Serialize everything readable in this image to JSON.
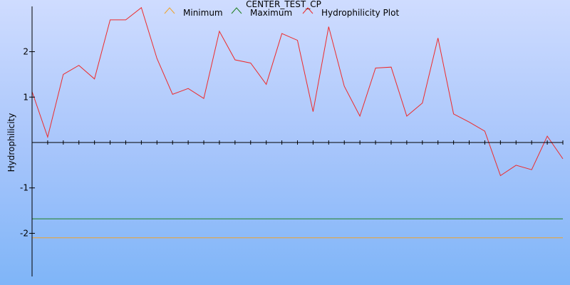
{
  "chart_data": {
    "type": "line",
    "title": "CENTER_TEST_CP",
    "xlabel": "",
    "ylabel": "Hydrophilicity",
    "ylim": [
      -2.95,
      2.95
    ],
    "xlim": [
      0,
      34
    ],
    "y_ticks": [
      2,
      1,
      -1,
      -2
    ],
    "y_tick_labels": [
      "2",
      "1",
      "-1",
      "-2"
    ],
    "legend": {
      "placement": "top-center",
      "entries": [
        "Minimum",
        "Maximum",
        "Hydrophilicity Plot"
      ]
    },
    "grid": false,
    "series": [
      {
        "name": "Minimum",
        "color": "#f0a22a",
        "x": [
          0,
          34
        ],
        "y": [
          -2.1,
          -2.1
        ]
      },
      {
        "name": "Maximum",
        "color": "#1f7f1f",
        "x": [
          0,
          34
        ],
        "y": [
          -1.68,
          -1.68
        ]
      },
      {
        "name": "Hydrophilicity Plot",
        "color": "#ee2a2a",
        "x": [
          0,
          1,
          2,
          3,
          4,
          5,
          6,
          7,
          8,
          9,
          10,
          11,
          12,
          13,
          14,
          15,
          16,
          17,
          18,
          19,
          20,
          21,
          22,
          23,
          24,
          25,
          26,
          27,
          28,
          29,
          30,
          31,
          32,
          33,
          34
        ],
        "y": [
          1.12,
          0.12,
          1.5,
          1.7,
          1.4,
          2.7,
          2.7,
          2.97,
          1.85,
          1.06,
          1.19,
          0.97,
          2.45,
          1.82,
          1.75,
          1.28,
          2.4,
          2.25,
          0.68,
          2.55,
          1.24,
          0.58,
          1.64,
          1.66,
          0.58,
          0.87,
          2.3,
          0.63,
          0.45,
          0.25,
          -0.73,
          -0.5,
          -0.6,
          0.14,
          -0.36
        ]
      }
    ]
  }
}
